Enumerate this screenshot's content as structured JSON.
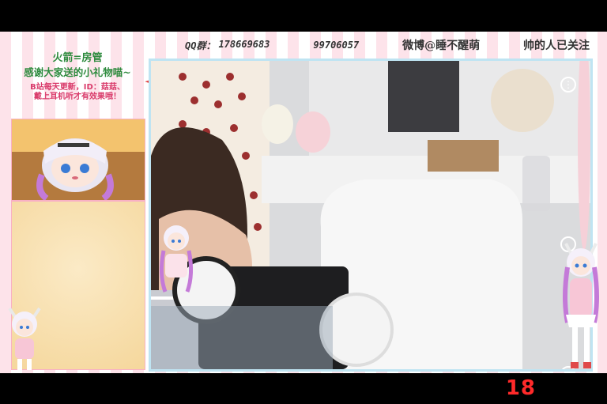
{
  "header": {
    "qq_group_label": "QQ群：",
    "qq_group_1": "178669683",
    "qq_group_2": "99706057",
    "weibo": "微博@睡不醒萌",
    "follow_note": "帅的人已关注"
  },
  "notice": {
    "line1": "火箭=房管",
    "line2": "感谢大家送的小礼物喵~",
    "sub1": "B站每天更新，ID：菇菇、",
    "sub2": "戴上耳机听才有效果哦！"
  },
  "stream": {
    "badge": "18"
  },
  "icons": {
    "more": "more-vertical-icon",
    "sidebar": "circle-icon",
    "rocket": "rocket-icon"
  },
  "colors": {
    "frame_pink": "#fde3ea",
    "border_blue": "#bfe4f2",
    "badge_red": "#ff2a2a",
    "notice_green": "#2e8b3e"
  }
}
